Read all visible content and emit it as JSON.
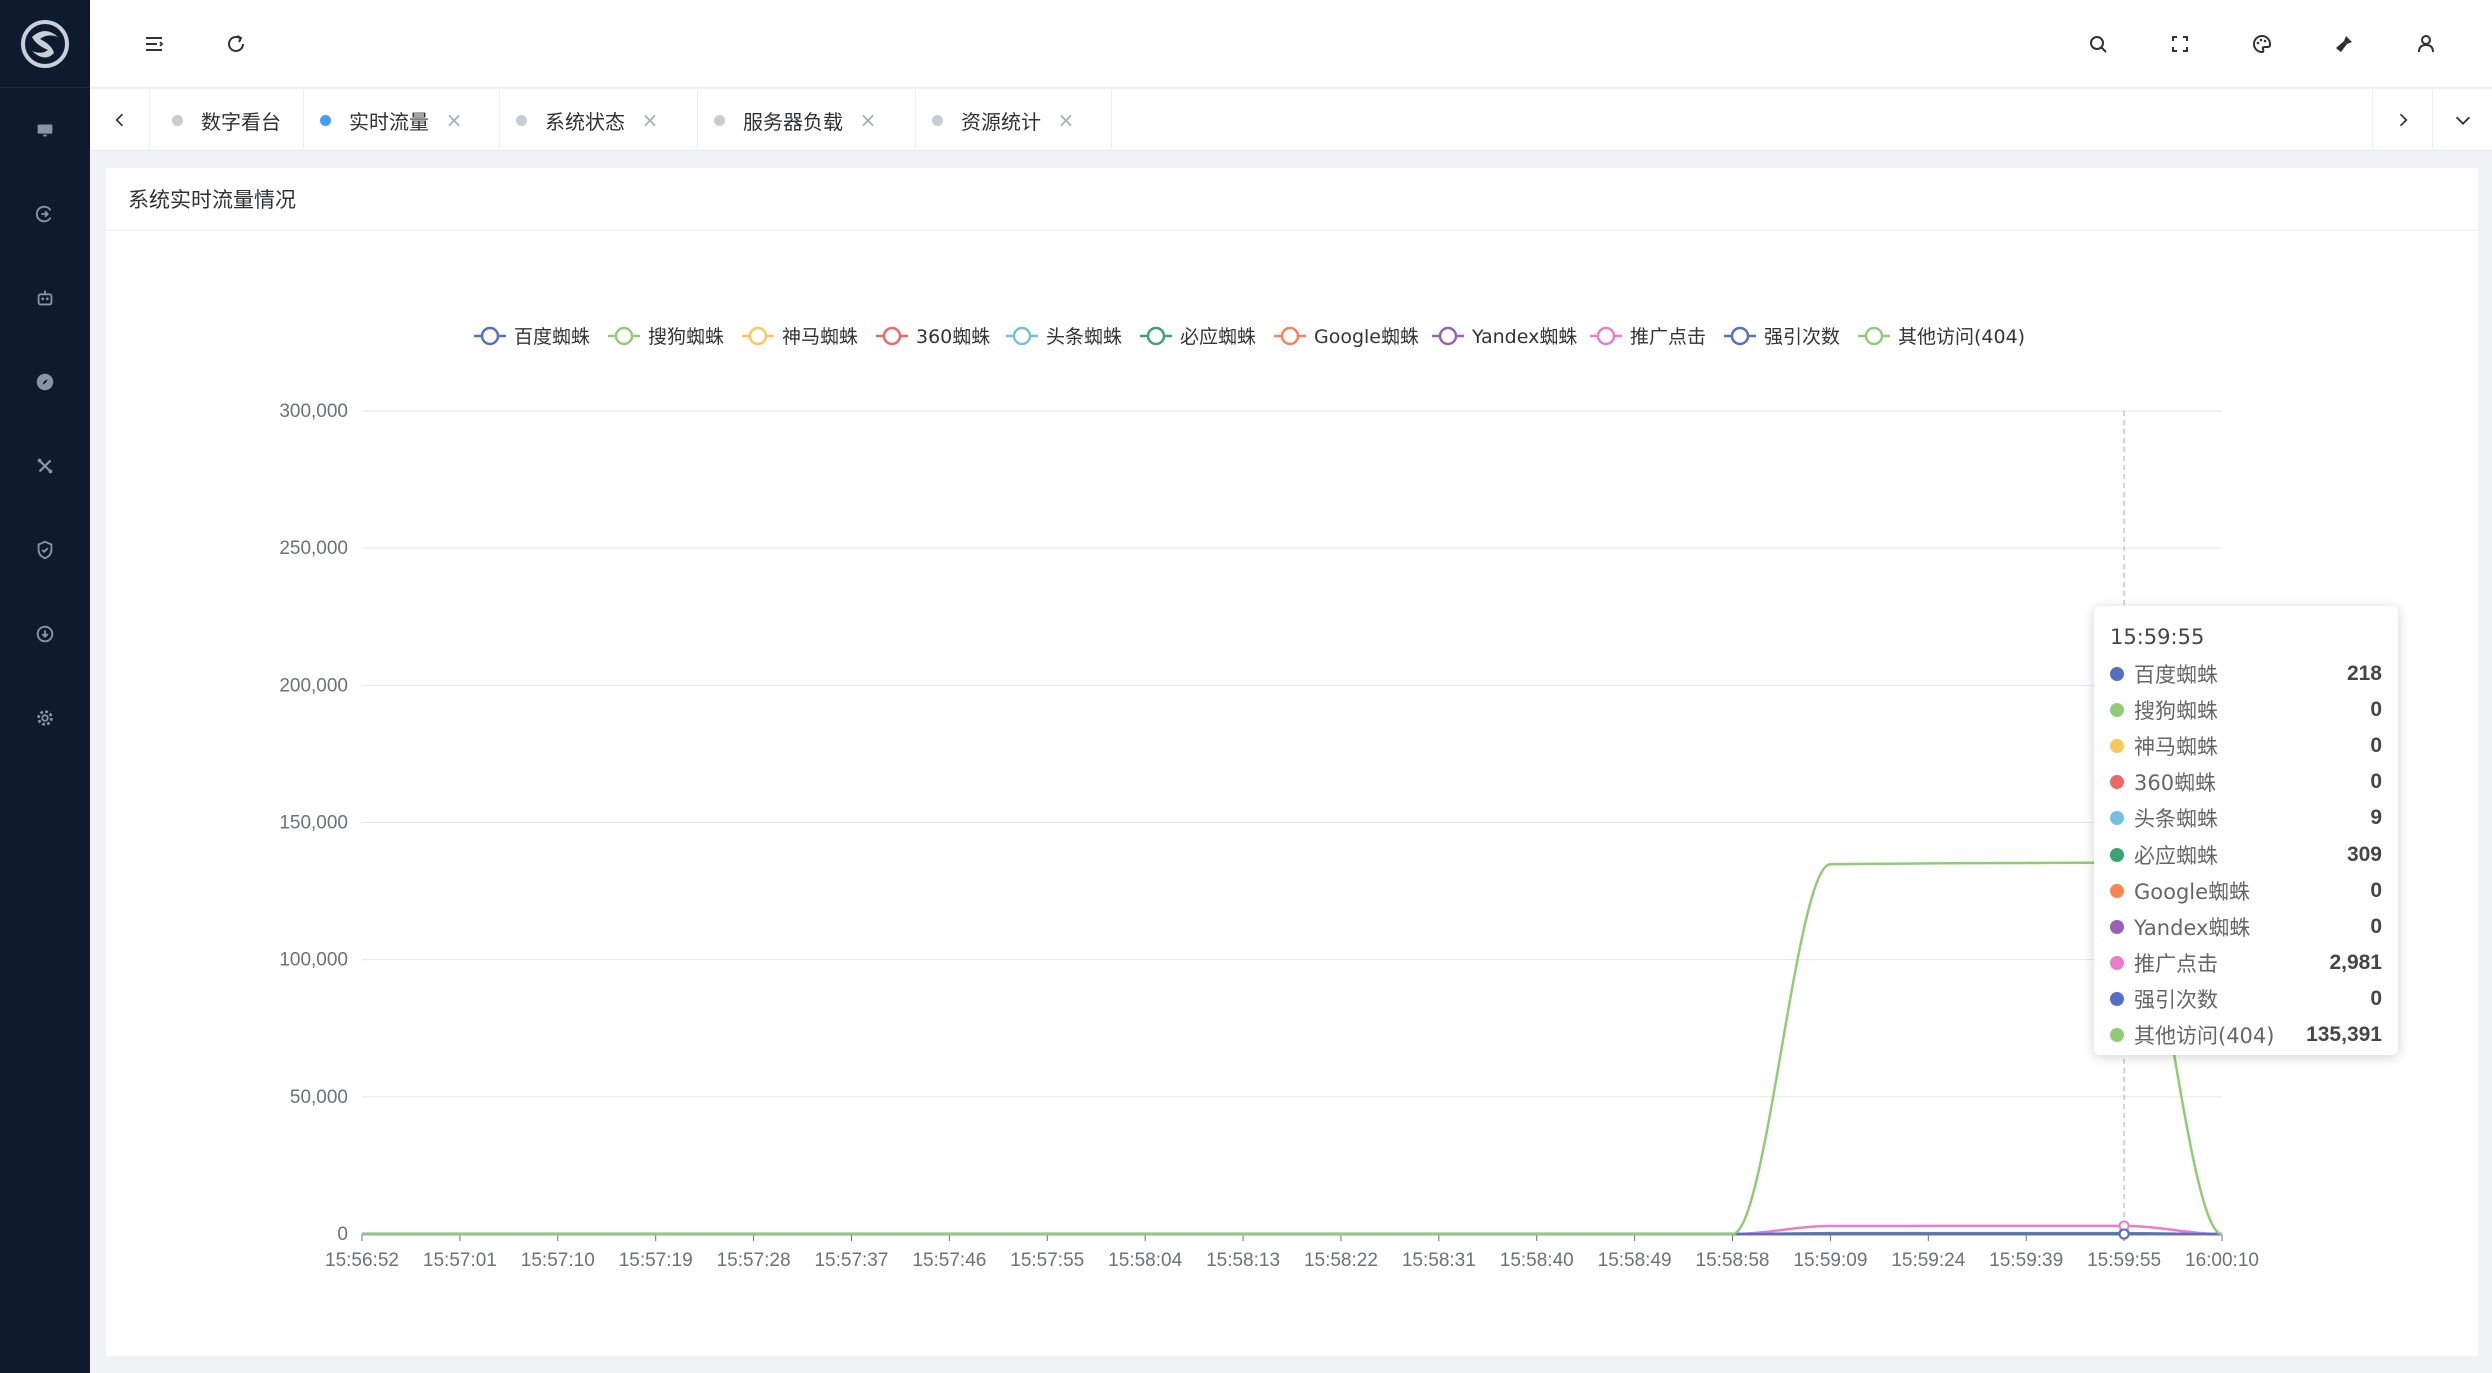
{
  "header": {
    "menu_icon": "menu-fold-icon",
    "refresh_icon": "refresh-icon",
    "right_icons": [
      "search-icon",
      "fullscreen-icon",
      "theme-palette-icon",
      "clear-cache-brush-icon",
      "user-icon"
    ]
  },
  "sidebar": {
    "items": [
      {
        "icon": "monitor-icon"
      },
      {
        "icon": "flow-icon"
      },
      {
        "icon": "robot-icon"
      },
      {
        "icon": "compass-icon"
      },
      {
        "icon": "tools-icon"
      },
      {
        "icon": "shield-icon"
      },
      {
        "icon": "download-icon"
      },
      {
        "icon": "gear-icon"
      }
    ]
  },
  "tabs": [
    {
      "label": "数字看台",
      "active": false,
      "closable": false
    },
    {
      "label": "实时流量",
      "active": true,
      "closable": true
    },
    {
      "label": "系统状态",
      "active": false,
      "closable": true
    },
    {
      "label": "服务器负载",
      "active": false,
      "closable": true
    },
    {
      "label": "资源统计",
      "active": false,
      "closable": true
    }
  ],
  "card": {
    "title": "系统实时流量情况"
  },
  "colors": {
    "sidebar_bg": "#0e1a2e",
    "accent": "#409eff"
  },
  "chart_data": {
    "type": "line",
    "title": "",
    "xlabel": "",
    "ylabel": "",
    "ylim": [
      0,
      300000
    ],
    "yticks": [
      "0",
      "50,000",
      "100,000",
      "150,000",
      "200,000",
      "250,000",
      "300,000"
    ],
    "x": [
      "15:56:52",
      "15:57:01",
      "15:57:10",
      "15:57:19",
      "15:57:28",
      "15:57:37",
      "15:57:46",
      "15:57:55",
      "15:58:04",
      "15:58:13",
      "15:58:22",
      "15:58:31",
      "15:58:40",
      "15:58:49",
      "15:58:58",
      "15:59:09",
      "15:59:24",
      "15:59:39",
      "15:59:55",
      "16:00:10"
    ],
    "legend_position": "top-center",
    "grid": true,
    "series": [
      {
        "name": "百度蜘蛛",
        "color": "#5470c6",
        "values": [
          0,
          0,
          0,
          0,
          0,
          0,
          0,
          0,
          0,
          0,
          0,
          0,
          0,
          0,
          0,
          210,
          215,
          216,
          218,
          0
        ]
      },
      {
        "name": "搜狗蜘蛛",
        "color": "#91cc75",
        "values": [
          0,
          0,
          0,
          0,
          0,
          0,
          0,
          0,
          0,
          0,
          0,
          0,
          0,
          0,
          0,
          0,
          0,
          0,
          0,
          0
        ]
      },
      {
        "name": "神马蜘蛛",
        "color": "#fac858",
        "values": [
          0,
          0,
          0,
          0,
          0,
          0,
          0,
          0,
          0,
          0,
          0,
          0,
          0,
          0,
          0,
          0,
          0,
          0,
          0,
          0
        ]
      },
      {
        "name": "360蜘蛛",
        "color": "#ee6666",
        "values": [
          0,
          0,
          0,
          0,
          0,
          0,
          0,
          0,
          0,
          0,
          0,
          0,
          0,
          0,
          0,
          0,
          0,
          0,
          0,
          0
        ]
      },
      {
        "name": "头条蜘蛛",
        "color": "#73c0de",
        "values": [
          0,
          0,
          0,
          0,
          0,
          0,
          0,
          0,
          0,
          0,
          0,
          0,
          0,
          0,
          0,
          8,
          9,
          9,
          9,
          0
        ]
      },
      {
        "name": "必应蜘蛛",
        "color": "#3ba272",
        "values": [
          0,
          0,
          0,
          0,
          0,
          0,
          0,
          0,
          0,
          0,
          0,
          0,
          0,
          0,
          0,
          300,
          305,
          307,
          309,
          0
        ]
      },
      {
        "name": "Google蜘蛛",
        "color": "#fc8452",
        "values": [
          0,
          0,
          0,
          0,
          0,
          0,
          0,
          0,
          0,
          0,
          0,
          0,
          0,
          0,
          0,
          0,
          0,
          0,
          0,
          0
        ]
      },
      {
        "name": "Yandex蜘蛛",
        "color": "#9a60b4",
        "values": [
          0,
          0,
          0,
          0,
          0,
          0,
          0,
          0,
          0,
          0,
          0,
          0,
          0,
          0,
          0,
          0,
          0,
          0,
          0,
          0
        ]
      },
      {
        "name": "推广点击",
        "color": "#ea7ccc",
        "values": [
          0,
          0,
          0,
          0,
          0,
          0,
          0,
          0,
          0,
          0,
          0,
          0,
          0,
          0,
          0,
          2900,
          2950,
          2970,
          2981,
          0
        ]
      },
      {
        "name": "强引次数",
        "color": "#5470c6",
        "values": [
          0,
          0,
          0,
          0,
          0,
          0,
          0,
          0,
          0,
          0,
          0,
          0,
          0,
          0,
          0,
          0,
          0,
          0,
          0,
          0
        ]
      },
      {
        "name": "其他访问(404)",
        "color": "#91cc75",
        "values": [
          0,
          0,
          0,
          0,
          0,
          0,
          0,
          0,
          0,
          0,
          0,
          0,
          0,
          0,
          0,
          134800,
          135100,
          135250,
          135391,
          0
        ]
      }
    ],
    "tooltip": {
      "title": "15:59:55",
      "rows": [
        {
          "name": "百度蜘蛛",
          "value": "218",
          "color": "#5470c6"
        },
        {
          "name": "搜狗蜘蛛",
          "value": "0",
          "color": "#91cc75"
        },
        {
          "name": "神马蜘蛛",
          "value": "0",
          "color": "#fac858"
        },
        {
          "name": "360蜘蛛",
          "value": "0",
          "color": "#ee6666"
        },
        {
          "name": "头条蜘蛛",
          "value": "9",
          "color": "#73c0de"
        },
        {
          "name": "必应蜘蛛",
          "value": "309",
          "color": "#3ba272"
        },
        {
          "name": "Google蜘蛛",
          "value": "0",
          "color": "#fc8452"
        },
        {
          "name": "Yandex蜘蛛",
          "value": "0",
          "color": "#9a60b4"
        },
        {
          "name": "推广点击",
          "value": "2,981",
          "color": "#ea7ccc"
        },
        {
          "name": "强引次数",
          "value": "0",
          "color": "#5470c6"
        },
        {
          "name": "其他访问(404)",
          "value": "135,391",
          "color": "#91cc75"
        }
      ]
    }
  }
}
